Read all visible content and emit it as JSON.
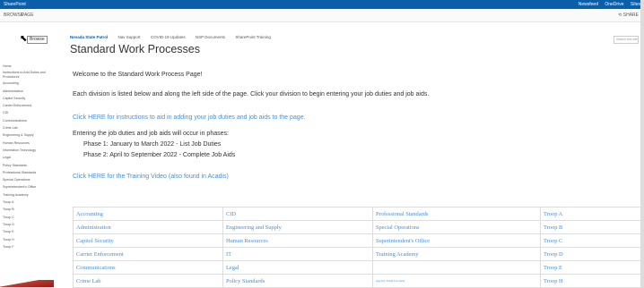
{
  "suite": {
    "brand": "SharePoint",
    "links": [
      "Newsfeed",
      "OneDrive",
      "Sites"
    ]
  },
  "ribbon": {
    "tabs": [
      "BROWSE",
      "PAGE"
    ],
    "share": "SHARE"
  },
  "topnav": [
    "Nevada State Patrol",
    "Nav Support",
    "COVID-19 Updates",
    "NSP Documents",
    "SharePoint Training"
  ],
  "tooltip": "Browse",
  "site_title": "Standard Work Processes",
  "search_placeholder": "Search this site",
  "leftnav": [
    "Home",
    "Instructions to Add Duties and Procedures",
    "Accounting",
    "Administration",
    "Capitol Security",
    "Carrier Enforcement",
    "CID",
    "Communications",
    "Crime Lab",
    "Engineering & Supply",
    "Human Resources",
    "Information Technology",
    "Legal",
    "Policy Standards",
    "Professional Standards",
    "Special Operations",
    "Superintendent's Office",
    "Training Academy",
    "Troop A",
    "Troop B",
    "Troop C",
    "Troop D",
    "Troop E",
    "Troop H",
    "Troop F"
  ],
  "content": {
    "welcome": "Welcome to the Standard Work Process Page!",
    "instructions": "Each division is listed below and along the left side of the page.  Click your division to begin entering your job duties and job aids.",
    "click_here": "Click HERE for instructions to aid in adding your job duties and job aids to the page.",
    "phases_intro": "Entering the job duties and job aids will occur in phases:",
    "phase1": "Phase 1: January to March 2022 - List Job Duties",
    "phase2": "Phase 2: April to September 2022 - Complete Job Aids",
    "training_video": "Click HERE for the Training Video (also found in Acadis)"
  },
  "divisions": [
    [
      "Accounting",
      "CID",
      "Professional Standards",
      "Troop A"
    ],
    [
      "Administration",
      "Engineering and Supply",
      "Special Operations",
      "Troop B"
    ],
    [
      "Capitol Security",
      "Human Resources",
      "Superintendent's Office",
      "Troop C"
    ],
    [
      "Carrier Enforcement",
      "IT",
      "Training Academy",
      "Troop D"
    ],
    [
      "Communications",
      "Legal",
      "",
      "Troop E"
    ],
    [
      "Crime Lab",
      "Policy Standards",
      "Agency Wide Job Aids",
      "Troop H"
    ]
  ]
}
